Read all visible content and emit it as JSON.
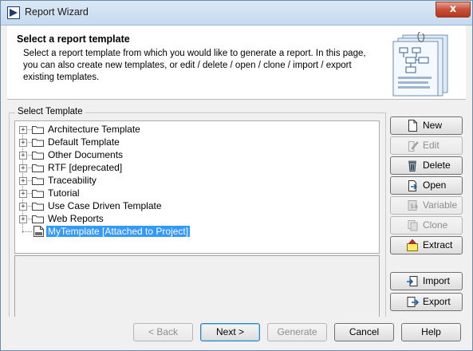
{
  "window": {
    "title": "Report Wizard",
    "close_label": "x"
  },
  "header": {
    "title": "Select a report template",
    "description": "Select a report template from which you would like to generate a report. In this page, you can also create new templates, or edit / delete / open / clone / import / export existing templates."
  },
  "group": {
    "label": "Select Template"
  },
  "tree": {
    "items": [
      {
        "label": "Architecture Template",
        "expander": "+",
        "icon": "folder-icon"
      },
      {
        "label": "Default Template",
        "expander": "+",
        "icon": "folder-icon"
      },
      {
        "label": "Other Documents",
        "expander": "+",
        "icon": "folder-icon"
      },
      {
        "label": "RTF [deprecated]",
        "expander": "+",
        "icon": "folder-icon"
      },
      {
        "label": "Traceability",
        "expander": "+",
        "icon": "folder-icon"
      },
      {
        "label": "Tutorial",
        "expander": "+",
        "icon": "folder-icon"
      },
      {
        "label": "Use Case Driven Template",
        "expander": "+",
        "icon": "folder-icon"
      },
      {
        "label": "Web Reports",
        "expander": "+",
        "icon": "folder-icon"
      },
      {
        "label": "MyTemplate [Attached to Project]",
        "icon": "document-icon",
        "selected": true
      }
    ]
  },
  "side_buttons": [
    {
      "label": "New",
      "icon": "new-document-icon",
      "enabled": true
    },
    {
      "label": "Edit",
      "icon": "edit-icon",
      "enabled": false
    },
    {
      "label": "Delete",
      "icon": "trash-icon",
      "enabled": true
    },
    {
      "label": "Open",
      "icon": "open-icon",
      "enabled": true
    },
    {
      "label": "Variable",
      "icon": "variable-icon",
      "enabled": false
    },
    {
      "label": "Clone",
      "icon": "clone-icon",
      "enabled": false
    },
    {
      "label": "Extract",
      "icon": "extract-icon",
      "enabled": true
    },
    {
      "label": "Import",
      "icon": "import-icon",
      "enabled": true
    },
    {
      "label": "Export",
      "icon": "export-icon",
      "enabled": true
    }
  ],
  "bottom_buttons": [
    {
      "label": "< Back",
      "enabled": false
    },
    {
      "label": "Next >",
      "enabled": true,
      "default": true
    },
    {
      "label": "Generate",
      "enabled": false
    },
    {
      "label": "Cancel",
      "enabled": true
    },
    {
      "label": "Help",
      "enabled": true
    }
  ],
  "colors": {
    "selection": "#3399ff",
    "title_bar": "#c6d9ee",
    "close_button": "#c6503a"
  }
}
